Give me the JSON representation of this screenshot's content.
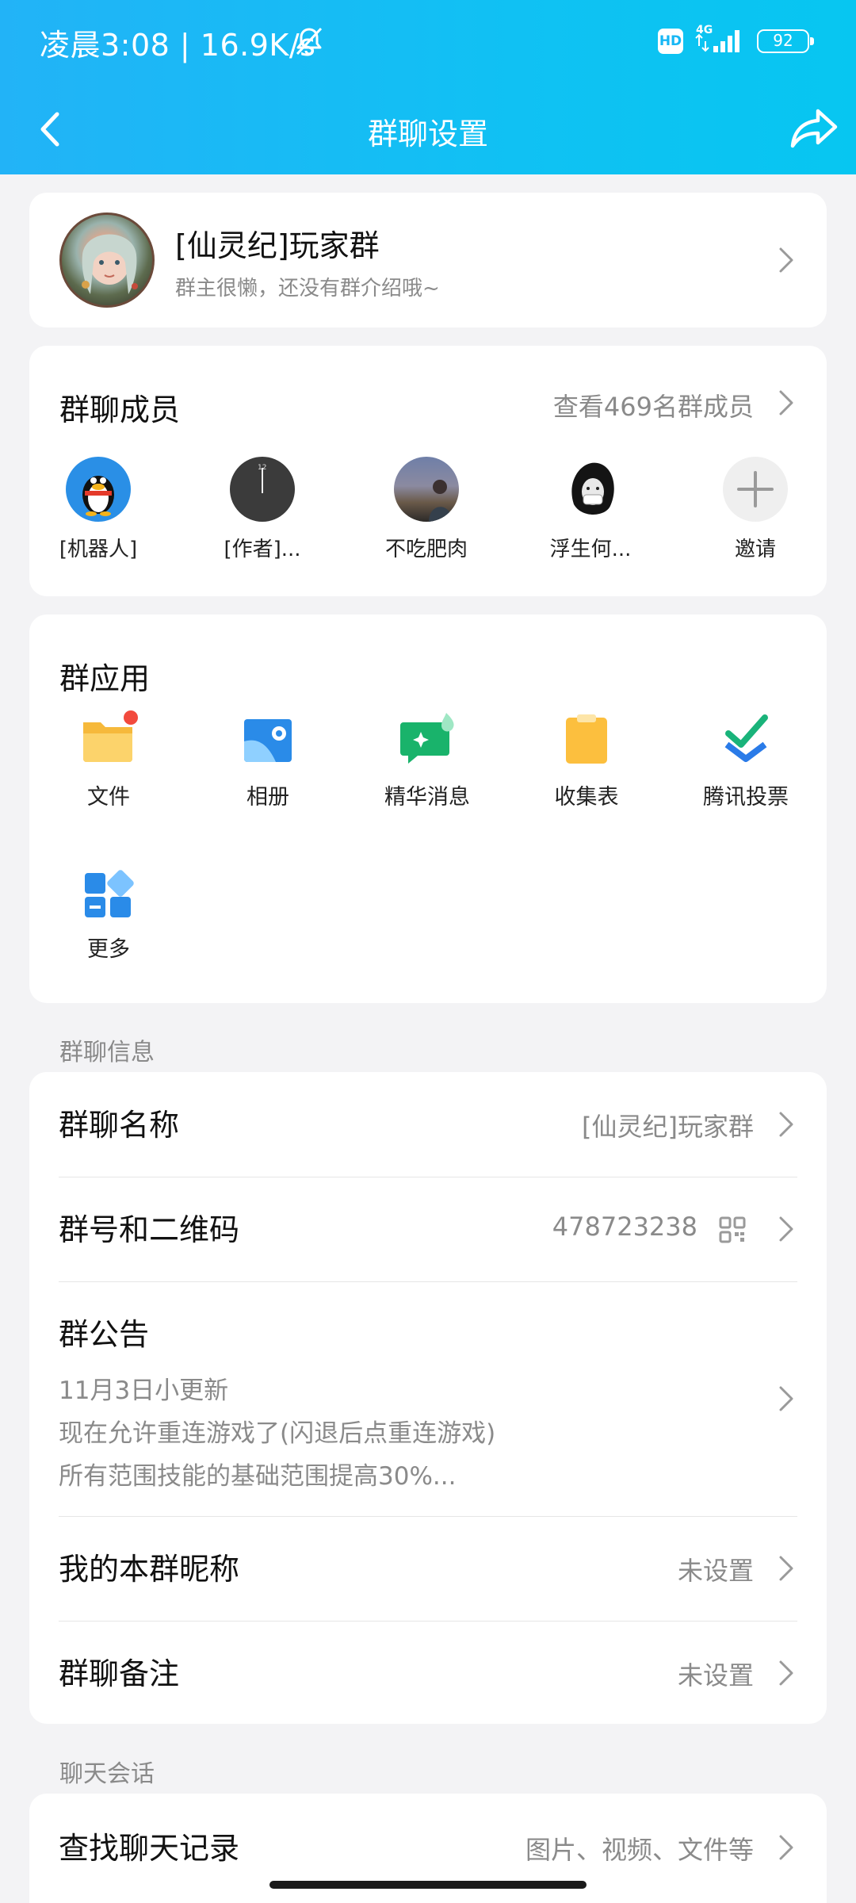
{
  "status_bar": {
    "time": "凌晨3:08 | 16.9K/s",
    "hd_label": "HD",
    "network": "4G",
    "battery": "92"
  },
  "nav": {
    "title": "群聊设置",
    "back_icon": "chevron-left-icon",
    "share_icon": "share-icon"
  },
  "group": {
    "name": "[仙灵纪]玩家群",
    "description": "群主很懒，还没有群介绍哦~"
  },
  "members": {
    "title": "群聊成员",
    "view_all": "查看469名群成员",
    "list": [
      {
        "name": "[机器人]"
      },
      {
        "name": "[作者]..."
      },
      {
        "name": "不吃肥肉"
      },
      {
        "name": "浮生何..."
      },
      {
        "name": "邀请"
      }
    ]
  },
  "apps": {
    "title": "群应用",
    "items": [
      {
        "label": "文件",
        "icon": "folder-icon"
      },
      {
        "label": "相册",
        "icon": "album-icon"
      },
      {
        "label": "精华消息",
        "icon": "essence-message-icon"
      },
      {
        "label": "收集表",
        "icon": "clipboard-icon"
      },
      {
        "label": "腾讯投票",
        "icon": "vote-icon"
      },
      {
        "label": "更多",
        "icon": "more-apps-icon"
      }
    ]
  },
  "info_section": {
    "label": "群聊信息",
    "group_name": {
      "title": "群聊名称",
      "value": "[仙灵纪]玩家群"
    },
    "group_number": {
      "title": "群号和二维码",
      "value": "478723238"
    },
    "notice": {
      "title": "群公告",
      "lines": [
        "11月3日小更新",
        "现在允许重连游戏了(闪退后点重连游戏)",
        "所有范围技能的基础范围提高30%..."
      ]
    },
    "my_nickname": {
      "title": "我的本群昵称",
      "value": "未设置"
    },
    "remark": {
      "title": "群聊备注",
      "value": "未设置"
    }
  },
  "chat_section": {
    "label": "聊天会话",
    "search_history": {
      "title": "查找聊天记录",
      "value": "图片、视频、文件等"
    }
  },
  "colors": {
    "header_start": "#22b3f7",
    "header_end": "#07c6f1",
    "background": "#f3f3f5",
    "secondary_text": "#8a8a8a",
    "badge_red": "#f24a3d"
  }
}
